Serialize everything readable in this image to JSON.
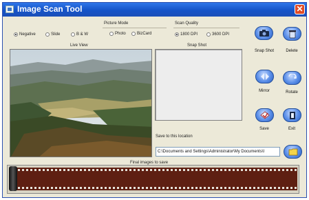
{
  "window": {
    "title": "Image Scan Tool"
  },
  "film_mode": {
    "options": [
      {
        "label": "Negative",
        "selected": true
      },
      {
        "label": "Slide",
        "selected": false
      },
      {
        "label": "B & W",
        "selected": false
      }
    ]
  },
  "picture_mode": {
    "label": "Picture Mode",
    "options": [
      {
        "label": "Photo",
        "selected": false
      },
      {
        "label": "BizCard",
        "selected": false
      }
    ]
  },
  "scan_quality": {
    "label": "Scan Quality",
    "options": [
      {
        "label": "1800 DPI",
        "selected": true
      },
      {
        "label": "3600 DPI",
        "selected": false
      }
    ]
  },
  "live_view": {
    "label": "Live View"
  },
  "snap_shot_panel": {
    "label": "Snap Shot"
  },
  "save_location": {
    "label": "Save to this location",
    "path": "C:\\Documents and Settings\\Administrator\\My Documents\\I"
  },
  "buttons": {
    "snap_shot": "Snap Shot",
    "delete": "Delete",
    "mirror": "Mirror",
    "rotate": "Rotate",
    "save": "Save",
    "exit": "Exit"
  },
  "final_images": {
    "label": "Final images to save"
  },
  "icons": [
    "app-icon",
    "close-icon",
    "camera-icon",
    "trash-icon",
    "mirror-icon",
    "rotate-icon",
    "save-icon",
    "exit-icon",
    "folder-icon",
    "film-canister-icon"
  ],
  "colors": {
    "titlebar": "#1553c8",
    "window_bg": "#ece9d8",
    "button": "#5a8ee8",
    "film": "#5e1f12",
    "close": "#e04b26"
  }
}
